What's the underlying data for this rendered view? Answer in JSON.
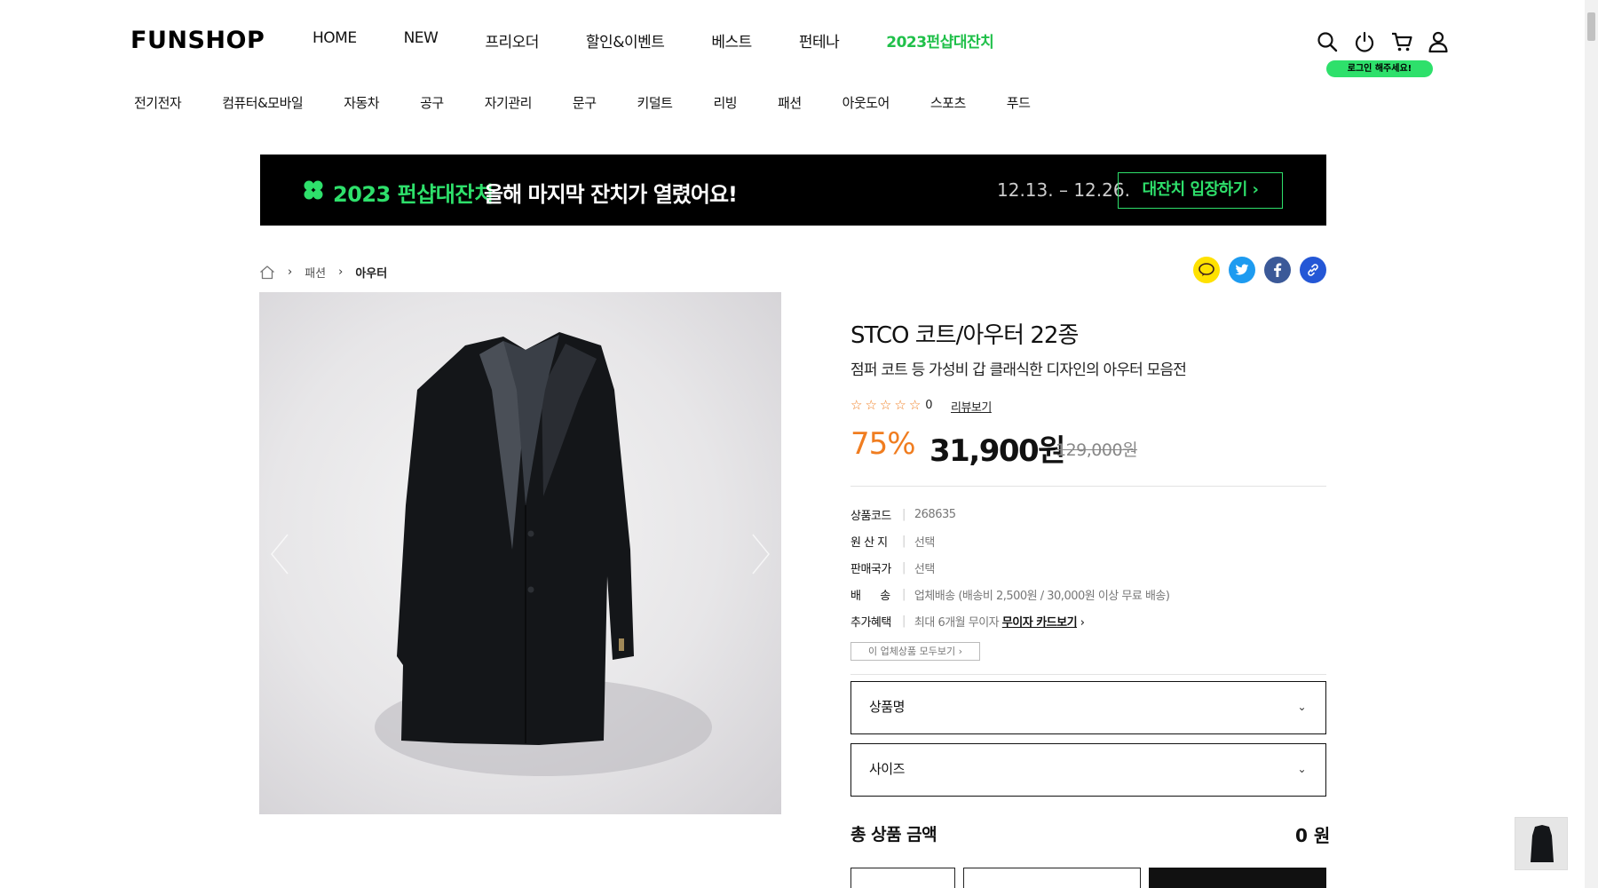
{
  "header": {
    "logo": "FUNSHOP",
    "gnb": [
      "HOME",
      "NEW",
      "프리오더",
      "할인&이벤트",
      "베스트",
      "펀테나",
      "2023펀샵대잔치"
    ],
    "login_badge": "로그인 해주세요!"
  },
  "categories": [
    "전기전자",
    "컴퓨터&모바일",
    "자동차",
    "공구",
    "자기관리",
    "문구",
    "키덜트",
    "리빙",
    "패션",
    "아웃도어",
    "스포츠",
    "푸드"
  ],
  "banner": {
    "title": "2023 펀샵대잔치",
    "subtitle": "올해 마지막 잔치가 열렸어요!",
    "date": "12.13. – 12.26.",
    "button": "대잔치 입장하기 ›"
  },
  "breadcrumb": {
    "level1": "패션",
    "level2": "아우터"
  },
  "product": {
    "title": "STCO 코트/아우터 22종",
    "description": "점퍼 코트 등 가성비 갑 클래식한 디자인의 아우터 모음전",
    "rating": 0,
    "review_link": "리뷰보기",
    "discount": "75%",
    "price": "31,900원",
    "original_price": "129,000원"
  },
  "specs": [
    {
      "key": "상품코드",
      "value": "268635"
    },
    {
      "key": "원 산 지",
      "value": "선택"
    },
    {
      "key": "판매국가",
      "value": "선택"
    },
    {
      "key": "배      송",
      "value": "업체배송 (배송비 2,500원 / 30,000원 이상 무료 배송)"
    },
    {
      "key": "추가혜택",
      "value": "최대 6개월 무이자",
      "link": "무이자 카드보기"
    }
  ],
  "vendor_button": "이 업체상품 모두보기 ›",
  "options": {
    "name": "상품명",
    "size": "사이즈"
  },
  "total": {
    "label": "총 상품 금액",
    "value": "0 원"
  },
  "colors": {
    "accent_green": "#2ee06b",
    "discount_orange": "#f07d20"
  }
}
